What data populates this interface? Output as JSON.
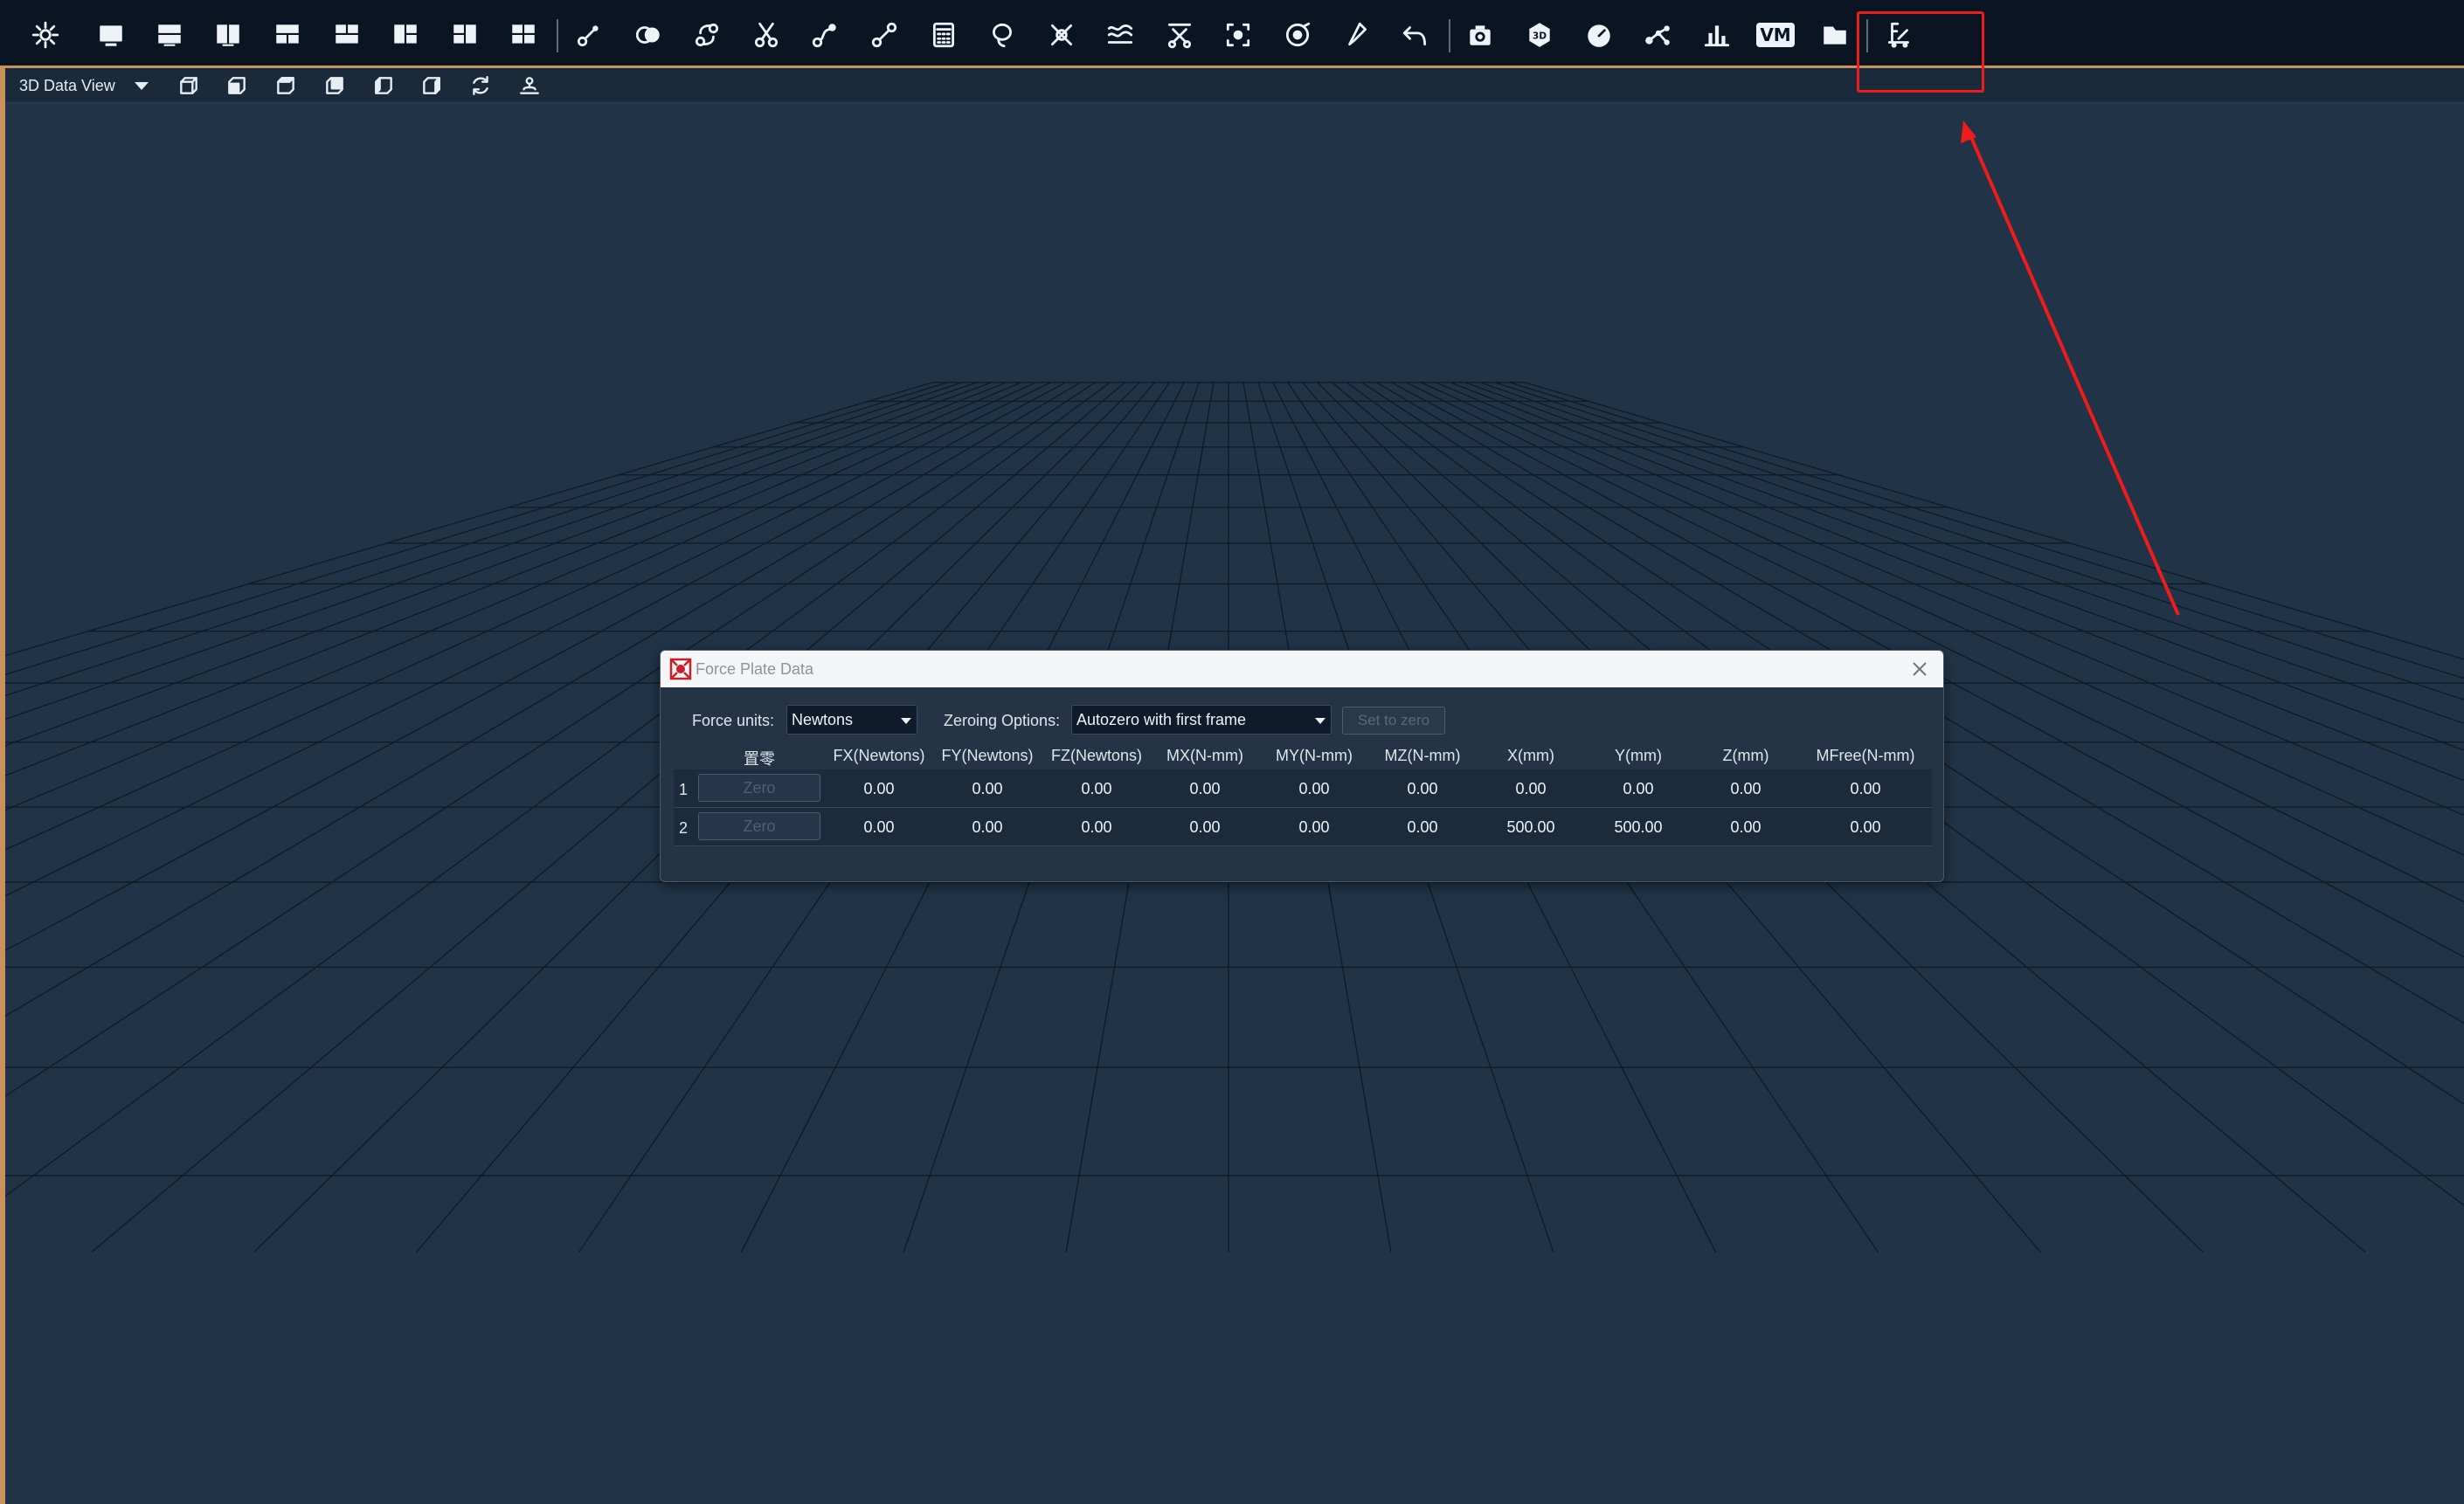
{
  "toolbar": {
    "icons": [
      "gear-icon",
      "layout-single-icon",
      "layout-two-rows-icon",
      "layout-two-columns-icon",
      "layout-three-top-icon",
      "layout-three-bottom-icon",
      "layout-three-left-icon",
      "layout-three-right-icon",
      "layout-four-icon",
      "markers-link-icon",
      "toggle-visibility-icon",
      "fill-gap-icon",
      "cut-icon",
      "spline-icon",
      "rigid-icon",
      "calculator-icon",
      "lasso-icon",
      "delete-markers-icon",
      "filter-icon",
      "trim-icon",
      "select-region-icon",
      "target-icon",
      "pen-icon",
      "undo-icon",
      "camera-icon",
      "3d-icon",
      "speed-gauge-icon",
      "skeleton-icon",
      "bar-chart-icon",
      "vm-icon",
      "folder-icon",
      "force-plate-icon"
    ],
    "vm_label": "VM",
    "threed_label": "3D"
  },
  "view": {
    "mode": "3D Data View",
    "tool_icons": [
      "view-top-icon",
      "view-front-icon",
      "view-side-icon",
      "view-back-icon",
      "view-left-icon",
      "view-right-icon",
      "refresh-icon",
      "recenter-icon"
    ]
  },
  "dialog": {
    "title": "Force Plate Data",
    "force_units_label": "Force units:",
    "force_units_value": "Newtons",
    "zeroing_label": "Zeroing Options:",
    "zeroing_value": "Autozero with first frame",
    "set_to_zero_label": "Set to zero",
    "columns": [
      "置零",
      "FX(Newtons)",
      "FY(Newtons)",
      "FZ(Newtons)",
      "MX(N-mm)",
      "MY(N-mm)",
      "MZ(N-mm)",
      "X(mm)",
      "Y(mm)",
      "Z(mm)",
      "MFree(N-mm)"
    ],
    "rows": [
      {
        "index": "1",
        "zero_label": "Zero",
        "values": [
          "0.00",
          "0.00",
          "0.00",
          "0.00",
          "0.00",
          "0.00",
          "0.00",
          "0.00",
          "0.00",
          "0.00"
        ]
      },
      {
        "index": "2",
        "zero_label": "Zero",
        "values": [
          "0.00",
          "0.00",
          "0.00",
          "0.00",
          "0.00",
          "0.00",
          "500.00",
          "500.00",
          "0.00",
          "0.00"
        ]
      }
    ]
  },
  "colors": {
    "annotation": "#ee1c1c",
    "accent_frame": "#c9925a",
    "viewport_bg": "#213447"
  }
}
